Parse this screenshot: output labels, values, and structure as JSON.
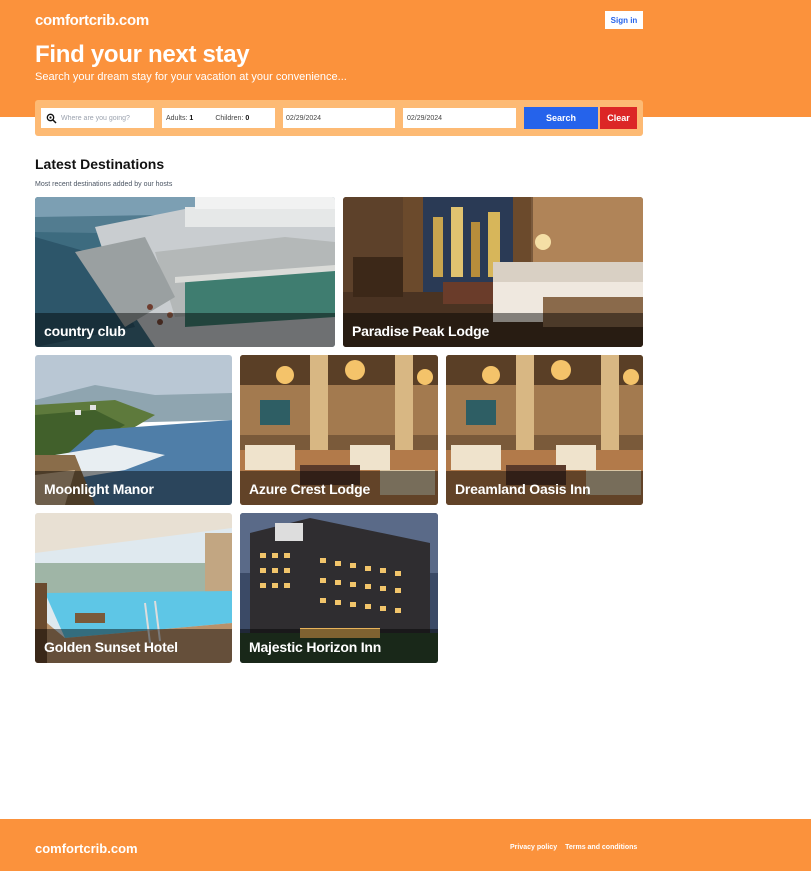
{
  "header": {
    "logo": "comfortcrib.com",
    "signin_label": "Sign in",
    "title": "Find your next stay",
    "subtitle": "Search your dream stay for your vacation at your convenience..."
  },
  "search": {
    "destination_placeholder": "Where are you going?",
    "adults_label": "Adults:",
    "adults_value": "1",
    "children_label": "Children:",
    "children_value": "0",
    "checkin": "02/29/2024",
    "checkout": "02/29/2024",
    "search_label": "Search",
    "clear_label": "Clear"
  },
  "destinations": {
    "title": "Latest Destinations",
    "subtitle": "Most recent destinations added by our hosts",
    "items": [
      {
        "name": "country club"
      },
      {
        "name": "Paradise Peak Lodge"
      },
      {
        "name": "Moonlight Manor"
      },
      {
        "name": "Azure Crest Lodge"
      },
      {
        "name": "Dreamland Oasis Inn"
      },
      {
        "name": "Golden Sunset Hotel"
      },
      {
        "name": "Majestic Horizon Inn"
      }
    ]
  },
  "footer": {
    "logo": "comfortcrib.com",
    "privacy_label": "Privacy policy",
    "terms_label": "Terms and conditions"
  },
  "colors": {
    "brand": "#fb923c",
    "search_bar": "#fdba74",
    "search_button": "#2563eb",
    "clear_button": "#dc2626"
  }
}
